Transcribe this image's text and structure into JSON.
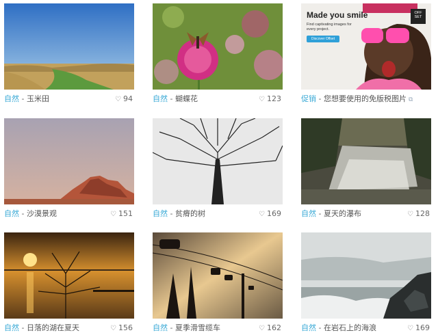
{
  "gallery": {
    "items": [
      {
        "category": "自然",
        "sep": " - ",
        "title": "玉米田",
        "likes": "94"
      },
      {
        "category": "自然",
        "sep": " - ",
        "title": "蝴蝶花",
        "likes": "123"
      },
      {
        "category": "促销",
        "sep": " - ",
        "title": "您想要使用的免版税图片",
        "likes": ""
      },
      {
        "category": "自然",
        "sep": " - ",
        "title": "沙漠景观",
        "likes": "151"
      },
      {
        "category": "自然",
        "sep": " - ",
        "title": "贫瘠的树",
        "likes": "169"
      },
      {
        "category": "自然",
        "sep": " - ",
        "title": "夏天的瀑布",
        "likes": "128"
      },
      {
        "category": "自然",
        "sep": " - ",
        "title": "日落的湖在夏天",
        "likes": "156"
      },
      {
        "category": "自然",
        "sep": " - ",
        "title": "夏季滑雪缆车",
        "likes": "162"
      },
      {
        "category": "自然",
        "sep": " - ",
        "title": "在岩石上的海浪",
        "likes": "169"
      }
    ]
  },
  "ad": {
    "headline": "Made you smile",
    "subtext": "Find captivating images for every project.",
    "button": "Discover Offset",
    "logo": "OFF SET"
  },
  "icons": {
    "heart": "♡",
    "external": "⧉"
  },
  "colors": {
    "category": "#39a9d6",
    "ad_button": "#2fa0d8"
  }
}
